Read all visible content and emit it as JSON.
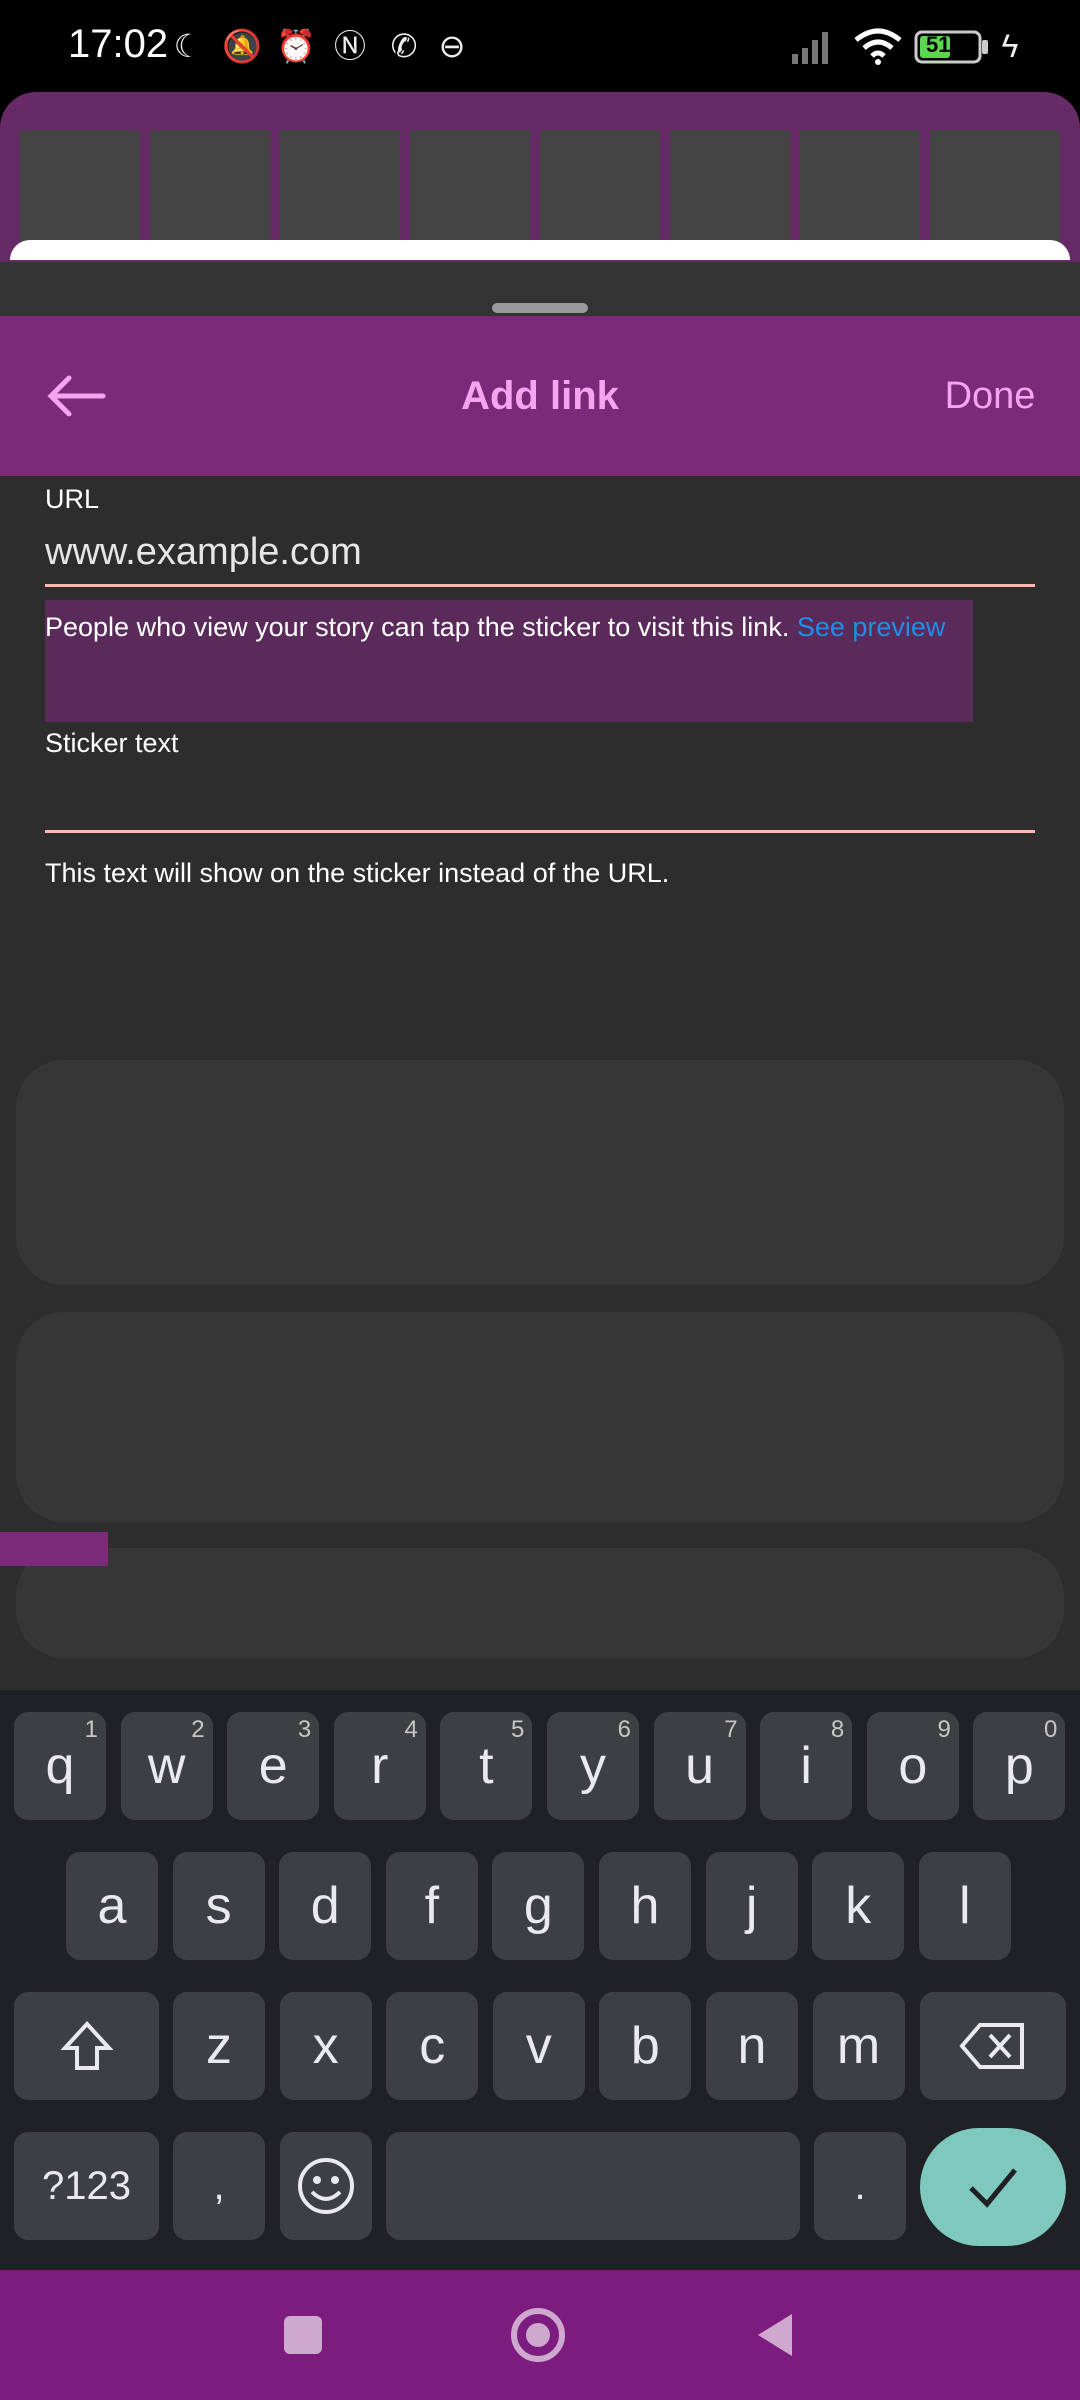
{
  "status_bar": {
    "time": "17:02",
    "battery_level": "51",
    "icons": [
      "moon-icon",
      "mute-icon",
      "alarm-icon",
      "nfc-icon",
      "whatsapp-icon",
      "app-icon",
      "signal-icon",
      "wifi-icon",
      "battery-icon",
      "charging-icon"
    ]
  },
  "header": {
    "title": "Add link",
    "done_label": "Done"
  },
  "form": {
    "url_label": "URL",
    "url_placeholder": "www.example.com",
    "url_help": "People who view your story can tap the sticker to visit this link. ",
    "see_preview": "See preview",
    "sticker_label": "Sticker text",
    "sticker_help": "This text will show on the sticker instead of the URL."
  },
  "keyboard": {
    "row1": [
      {
        "key": "q",
        "hint": "1"
      },
      {
        "key": "w",
        "hint": "2"
      },
      {
        "key": "e",
        "hint": "3"
      },
      {
        "key": "r",
        "hint": "4"
      },
      {
        "key": "t",
        "hint": "5"
      },
      {
        "key": "y",
        "hint": "6"
      },
      {
        "key": "u",
        "hint": "7"
      },
      {
        "key": "i",
        "hint": "8"
      },
      {
        "key": "o",
        "hint": "9"
      },
      {
        "key": "p",
        "hint": "0"
      }
    ],
    "row2": [
      "a",
      "s",
      "d",
      "f",
      "g",
      "h",
      "j",
      "k",
      "l"
    ],
    "row3": [
      "z",
      "x",
      "c",
      "v",
      "b",
      "n",
      "m"
    ],
    "symbols_label": "?123",
    "comma": ",",
    "period": "."
  },
  "colors": {
    "accent_link": "#1e8ee8",
    "title_pink": "#f3a6ef",
    "enter_key": "#7ec8bd"
  }
}
